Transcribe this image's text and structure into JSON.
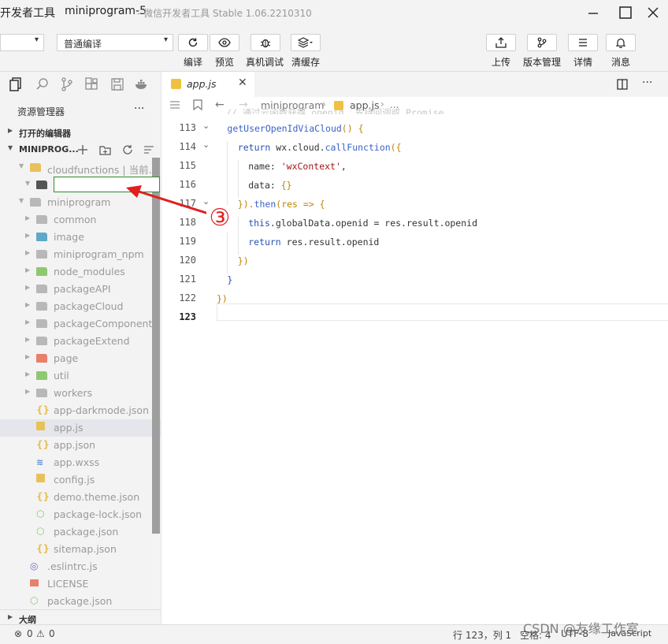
{
  "window": {
    "app_name": "开发者工具",
    "project": "miniprogram-5",
    "version": "- 微信开发者工具 Stable 1.06.2210310"
  },
  "toolbar": {
    "mode_select": "",
    "compile_mode": "普通编译",
    "buttons": [
      {
        "label": "编译",
        "icon": "refresh-icon"
      },
      {
        "label": "预览",
        "icon": "eye-icon"
      },
      {
        "label": "真机调试",
        "icon": "bug-icon"
      },
      {
        "label": "清缓存",
        "icon": "layers-icon"
      }
    ],
    "right_buttons": [
      {
        "label": "上传",
        "icon": "upload-icon"
      },
      {
        "label": "版本管理",
        "icon": "branch-icon"
      },
      {
        "label": "详情",
        "icon": "menu-icon"
      },
      {
        "label": "消息",
        "icon": "bell-icon"
      }
    ]
  },
  "sidebar": {
    "title": "资源管理器",
    "more": "···",
    "open_editors": "打开的编辑器",
    "project_section": "MINIPROG...",
    "outline": "大纲",
    "tree": [
      {
        "label": "cloudfunctions | 当前...",
        "indent": 1,
        "type": "folder-open",
        "color": "#e8c158"
      },
      {
        "label": "",
        "indent": 2,
        "type": "rename",
        "color": "#666"
      },
      {
        "label": "miniprogram",
        "indent": 1,
        "type": "folder-open",
        "color": "#b8b8b8"
      },
      {
        "label": "common",
        "indent": 2,
        "type": "folder",
        "color": "#b8b8b8"
      },
      {
        "label": "image",
        "indent": 2,
        "type": "folder",
        "color": "#5fa8c8"
      },
      {
        "label": "miniprogram_npm",
        "indent": 2,
        "type": "folder",
        "color": "#b8b8b8"
      },
      {
        "label": "node_modules",
        "indent": 2,
        "type": "folder",
        "color": "#8fc870"
      },
      {
        "label": "packageAPI",
        "indent": 2,
        "type": "folder",
        "color": "#b8b8b8"
      },
      {
        "label": "packageCloud",
        "indent": 2,
        "type": "folder",
        "color": "#b8b8b8"
      },
      {
        "label": "packageComponent",
        "indent": 2,
        "type": "folder",
        "color": "#b8b8b8"
      },
      {
        "label": "packageExtend",
        "indent": 2,
        "type": "folder",
        "color": "#b8b8b8"
      },
      {
        "label": "page",
        "indent": 2,
        "type": "folder",
        "color": "#e8806a"
      },
      {
        "label": "util",
        "indent": 2,
        "type": "folder",
        "color": "#8fc870"
      },
      {
        "label": "workers",
        "indent": 2,
        "type": "folder",
        "color": "#b8b8b8"
      },
      {
        "label": "app-darkmode.json",
        "indent": 2,
        "type": "json",
        "color": "#e8c158"
      },
      {
        "label": "app.js",
        "indent": 2,
        "type": "js",
        "color": "#e8c158",
        "selected": true
      },
      {
        "label": "app.json",
        "indent": 2,
        "type": "json",
        "color": "#e8c158"
      },
      {
        "label": "app.wxss",
        "indent": 2,
        "type": "css",
        "color": "#5a8ed8"
      },
      {
        "label": "config.js",
        "indent": 2,
        "type": "js",
        "color": "#e8c158"
      },
      {
        "label": "demo.theme.json",
        "indent": 2,
        "type": "json",
        "color": "#e8c158"
      },
      {
        "label": "package-lock.json",
        "indent": 2,
        "type": "npm",
        "color": "#8fc870"
      },
      {
        "label": "package.json",
        "indent": 2,
        "type": "npm",
        "color": "#8fc870"
      },
      {
        "label": "sitemap.json",
        "indent": 2,
        "type": "json",
        "color": "#e8c158"
      },
      {
        "label": ".eslintrc.js",
        "indent": 1,
        "type": "eslint",
        "color": "#7b68c8"
      },
      {
        "label": "LICENSE",
        "indent": 1,
        "type": "license",
        "color": "#e8806a"
      },
      {
        "label": "package.json",
        "indent": 1,
        "type": "npm",
        "color": "#8fc870"
      }
    ]
  },
  "editor": {
    "tab_label": "app.js",
    "breadcrumb": [
      "miniprogram",
      "app.js",
      "..."
    ],
    "top_partial": "// 通过云函数获得 openid, 支持回调或 Promise",
    "lines": [
      {
        "n": "113",
        "fold": true
      },
      {
        "n": "114",
        "fold": true
      },
      {
        "n": "115"
      },
      {
        "n": "116"
      },
      {
        "n": "117",
        "fold": true
      },
      {
        "n": "118"
      },
      {
        "n": "119"
      },
      {
        "n": "120"
      },
      {
        "n": "121"
      },
      {
        "n": "122"
      },
      {
        "n": "123"
      }
    ],
    "code": [
      [
        {
          "t": "getUserOpenIdViaCloud",
          "c": "fn"
        },
        {
          "t": "() {",
          "c": "br"
        }
      ],
      [
        {
          "t": "return ",
          "c": "kw"
        },
        {
          "t": "wx.cloud.",
          "c": ""
        },
        {
          "t": "callFunction",
          "c": "fn"
        },
        {
          "t": "({",
          "c": "br"
        }
      ],
      [
        {
          "t": "name: ",
          "c": ""
        },
        {
          "t": "'wxContext'",
          "c": "str"
        },
        {
          "t": ",",
          "c": ""
        }
      ],
      [
        {
          "t": "data: ",
          "c": ""
        },
        {
          "t": "{}",
          "c": "br"
        }
      ],
      [
        {
          "t": "}).",
          "c": "br"
        },
        {
          "t": "then",
          "c": "fn"
        },
        {
          "t": "(res => {",
          "c": "br"
        }
      ],
      [
        {
          "t": "this",
          "c": "kw"
        },
        {
          "t": ".globalData.openid = res.result.openid",
          "c": ""
        }
      ],
      [
        {
          "t": "return ",
          "c": "kw"
        },
        {
          "t": "res.result.openid",
          "c": ""
        }
      ],
      [
        {
          "t": "})",
          "c": "br"
        }
      ],
      [
        {
          "t": "}",
          "c": "kw"
        }
      ],
      [
        {
          "t": "})",
          "c": "br"
        }
      ],
      []
    ],
    "indents": [
      1,
      2,
      3,
      3,
      2,
      3,
      3,
      2,
      1,
      0,
      0
    ]
  },
  "annotation": {
    "label": "③",
    "color": "#e02020"
  },
  "status": {
    "errors": "0",
    "warnings": "0",
    "position": "行 123，列 1",
    "spaces": "空格: 4",
    "encoding": "UTF-8",
    "language": "JavaScript",
    "watermark": "CSDN @友缘工作室"
  }
}
